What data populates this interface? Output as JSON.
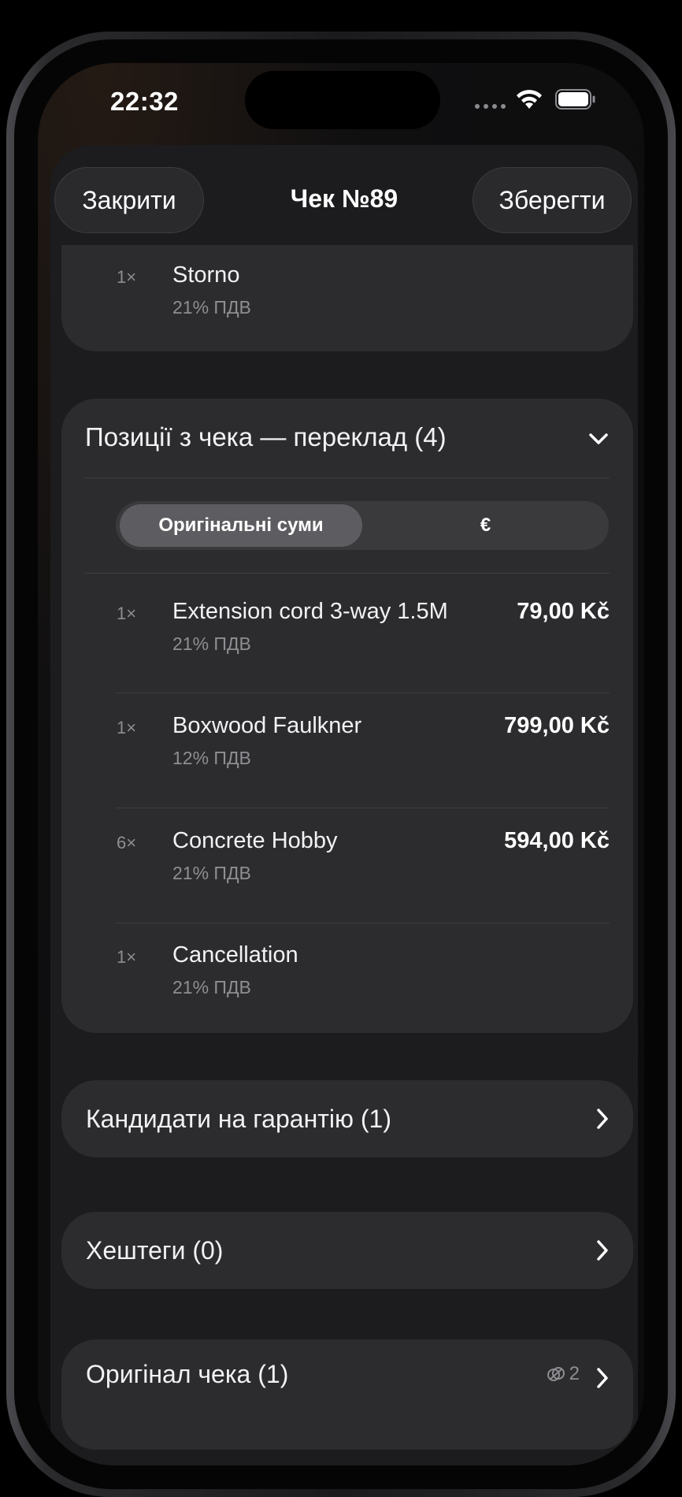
{
  "status_bar": {
    "time": "22:32"
  },
  "header": {
    "close_label": "Закрити",
    "title": "Чек №89",
    "save_label": "Зберегти"
  },
  "top_item": {
    "qty": "1×",
    "name": "Storno",
    "vat": "21% ПДВ"
  },
  "items_section": {
    "title": "Позиції з чека — переклад (4)",
    "segment": {
      "selected": "Оригінальні суми",
      "other": "€"
    },
    "items": [
      {
        "qty": "1×",
        "name": "Extension cord 3-way 1.5M",
        "vat": "21% ПДВ",
        "price": "79,00 Kč"
      },
      {
        "qty": "1×",
        "name": "Boxwood Faulkner",
        "vat": "12% ПДВ",
        "price": "799,00 Kč"
      },
      {
        "qty": "6×",
        "name": "Concrete Hobby",
        "vat": "21% ПДВ",
        "price": "594,00 Kč"
      },
      {
        "qty": "1×",
        "name": "Cancellation",
        "vat": "21% ПДВ",
        "price": ""
      }
    ]
  },
  "warranty": {
    "label": "Кандидати на гарантію (1)"
  },
  "hashtags": {
    "label": "Хештеги (0)"
  },
  "original": {
    "label": "Оригінал чека (1)",
    "attachment_count": "2"
  },
  "colors": {
    "background": "#000000",
    "sheet": "#1c1c1e",
    "card": "#2c2c2e",
    "segment_selected": "#5d5d61",
    "secondary_text": "#8e8e93"
  }
}
